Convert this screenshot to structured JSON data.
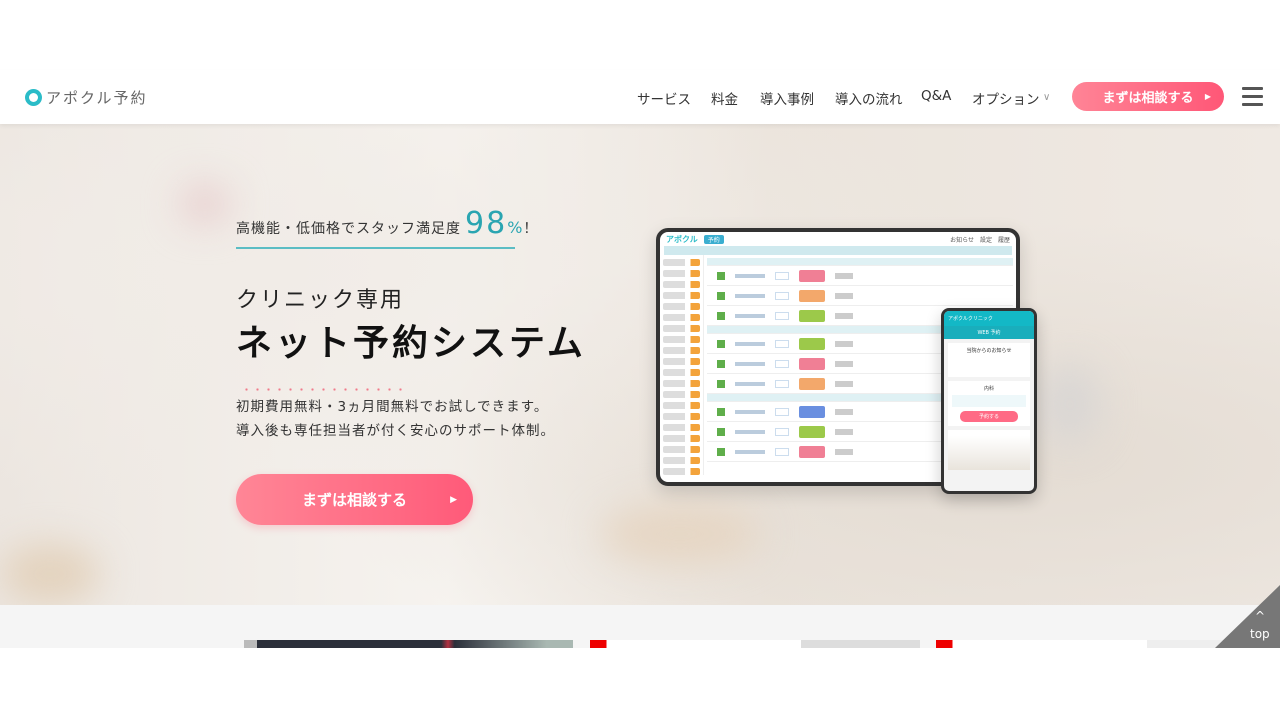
{
  "header": {
    "logo_text": "アポクル予約",
    "nav": [
      {
        "label": "サービス"
      },
      {
        "label": "料金"
      },
      {
        "label": "導入事例"
      },
      {
        "label": "導入の流れ"
      },
      {
        "label": "Q&A"
      },
      {
        "label": "オプション"
      }
    ],
    "cta_label": "まずは相談する"
  },
  "hero": {
    "tagline": "高機能・低価格でスタッフ満足度",
    "percent": "98",
    "percent_unit": "%",
    "exclaim": "！",
    "subtitle": "クリニック専用",
    "title": "ネット予約システム",
    "desc1": "初期費用無料・3ヵ月間無料でお試しできます。",
    "desc2": "導入後も専任担当者が付く安心のサポート体制。",
    "cta_label": "まずは相談する"
  },
  "mockup": {
    "tablet_brand": "アポクル",
    "tablet_tab": "予約",
    "tablet_menu": [
      "お知らせ",
      "設定",
      "履歴"
    ],
    "phone_title": "アポクルクリニック",
    "phone_sub": "WEB 予約",
    "phone_notice": "当院からのお知らせ",
    "phone_dept": "内科",
    "phone_button": "予約する"
  },
  "to_top": {
    "label": "top"
  },
  "colors": {
    "accent_teal": "#2aa5b1",
    "cta_pink": "#ff5a79"
  }
}
